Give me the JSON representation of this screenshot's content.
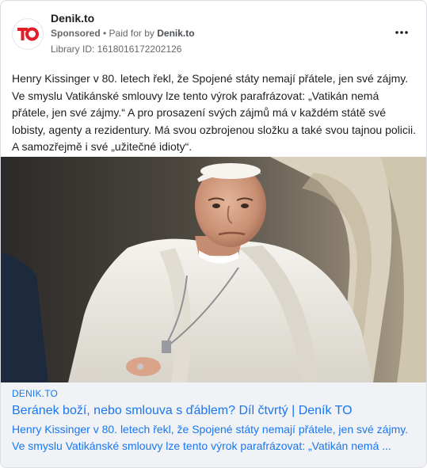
{
  "post": {
    "page_name": "Denik.to",
    "sponsored_label": "Sponsored",
    "separator": " • ",
    "paid_for_prefix": "Paid for by ",
    "paid_for_by": "Denik.to",
    "library_id": "Library ID: 1618016172202126",
    "body_text": "Henry Kissinger v 80. letech řekl, že Spojené státy nemají přátele, jen své zájmy. Ve smyslu Vatikánské smlouvy lze tento výrok parafrázovat: „Vatikán nemá přátele, jen své zájmy.“ A pro prosazení svých zájmů má v každém státě své lobisty, agenty a rezidentury. Má svou ozbrojenou složku a také svou tajnou policii. A samozřejmě i své „užitečné idioty“.",
    "avatar_logo": "TO",
    "more_icon": "more-horizontal-icon"
  },
  "link_preview": {
    "domain": "DENIK.TO",
    "title": "Beránek boží, nebo smlouva s ďáblem? Díl čtvrtý | Deník TO",
    "description_line1": "Henry Kissinger v 80. letech řekl, že Spojené státy nemají přátele, jen své zájmy.",
    "description_line2": "Ve smyslu Vatikánské smlouvy lze tento výrok parafrázovat: „Vatikán nemá ..."
  },
  "colors": {
    "brand_red": "#e11d2a",
    "link_blue": "#1877f2",
    "meta_gray": "#65676b",
    "preview_bg": "#f0f2f5"
  }
}
